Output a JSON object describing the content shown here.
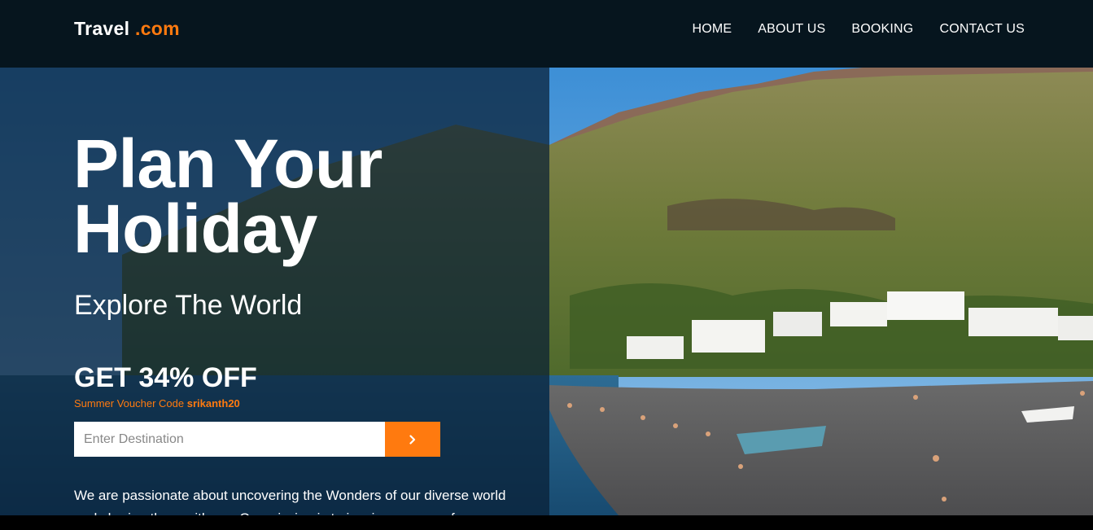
{
  "header": {
    "logo_main": "Travel",
    "logo_accent": ".com",
    "nav": [
      "HOME",
      "ABOUT US",
      "BOOKING",
      "CONTACT US"
    ]
  },
  "hero": {
    "title_line1": "Plan Your",
    "title_line2": "Holiday",
    "subtitle": "Explore The World",
    "offer": "GET 34% OFF",
    "voucher_label": "Summer Voucher Code",
    "voucher_code": "srikanth20",
    "search_placeholder": "Enter Destination",
    "search_button_icon": "chevron-right-icon",
    "description": "We are passionate about uncovering the Wonders of our diverse world and sharing them with you Our mission is to inspire a sense of"
  },
  "colors": {
    "header_bg": "#06151e",
    "accent": "#ff7a0f",
    "panel_overlay": "#081e34"
  }
}
